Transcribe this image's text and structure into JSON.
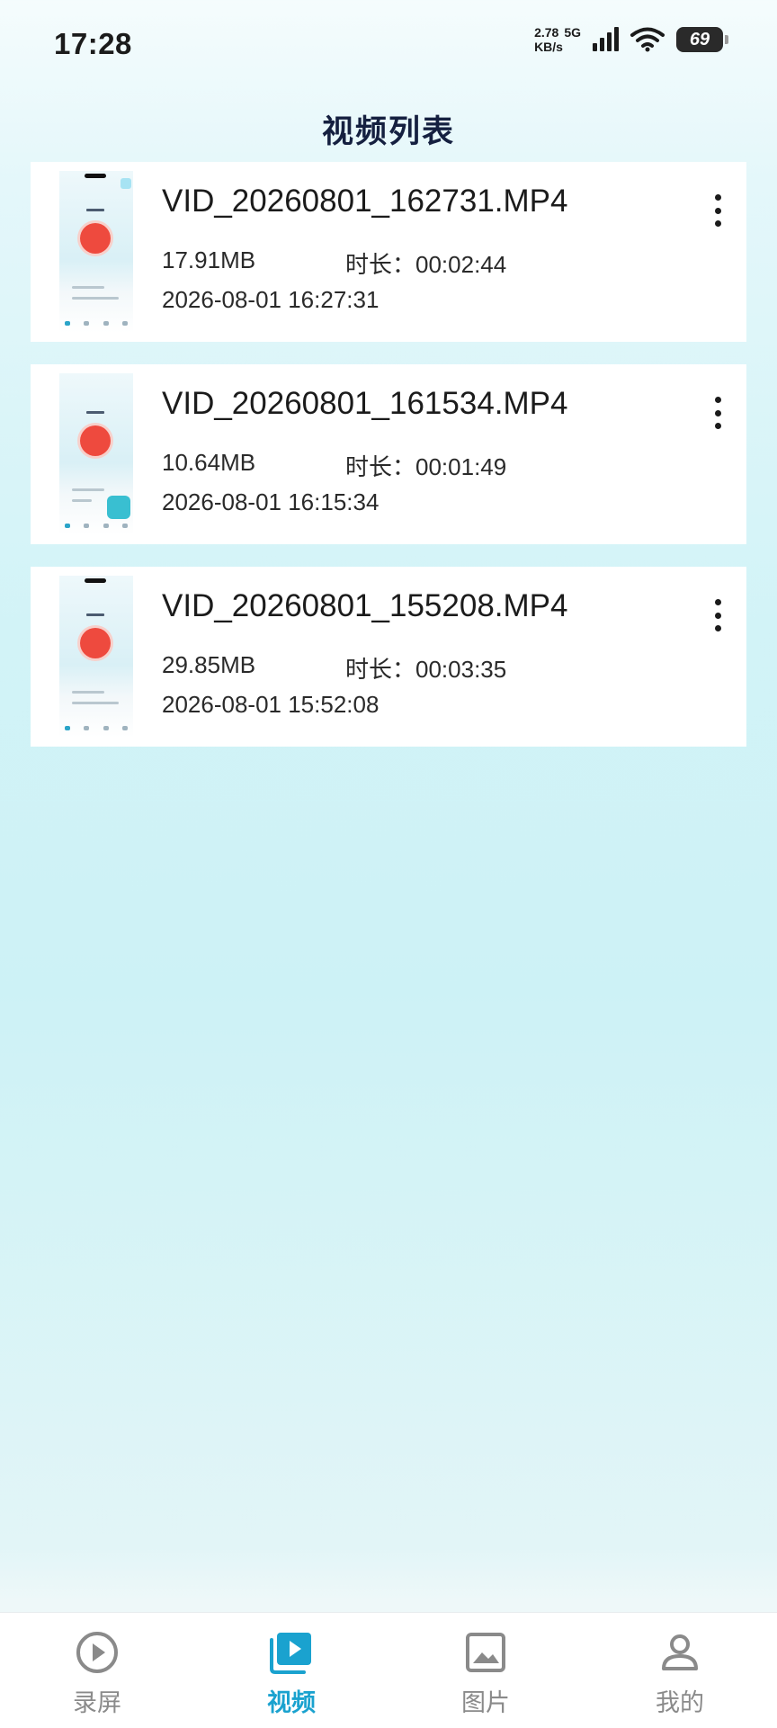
{
  "status_bar": {
    "time": "17:28",
    "net_speed_value": "2.78",
    "net_type": "5G",
    "net_speed_unit": "KB/s",
    "battery": "69"
  },
  "header": {
    "title": "视频列表"
  },
  "videos": [
    {
      "name": "VID_20260801_162731.MP4",
      "size": "17.91MB",
      "duration": "时长：00:02:44",
      "date": "2026-08-01 16:27:31"
    },
    {
      "name": "VID_20260801_161534.MP4",
      "size": "10.64MB",
      "duration": "时长：00:01:49",
      "date": "2026-08-01 16:15:34"
    },
    {
      "name": "VID_20260801_155208.MP4",
      "size": "29.85MB",
      "duration": "时长：00:03:35",
      "date": "2026-08-01 15:52:08"
    }
  ],
  "bottom_nav": {
    "items": [
      {
        "label": "录屏",
        "icon": "play-circle-icon"
      },
      {
        "label": "视频",
        "icon": "video-library-icon"
      },
      {
        "label": "图片",
        "icon": "image-icon"
      },
      {
        "label": "我的",
        "icon": "person-icon"
      }
    ],
    "active_color": "#1aa2cf",
    "inactive_color": "#8a8a8a"
  }
}
